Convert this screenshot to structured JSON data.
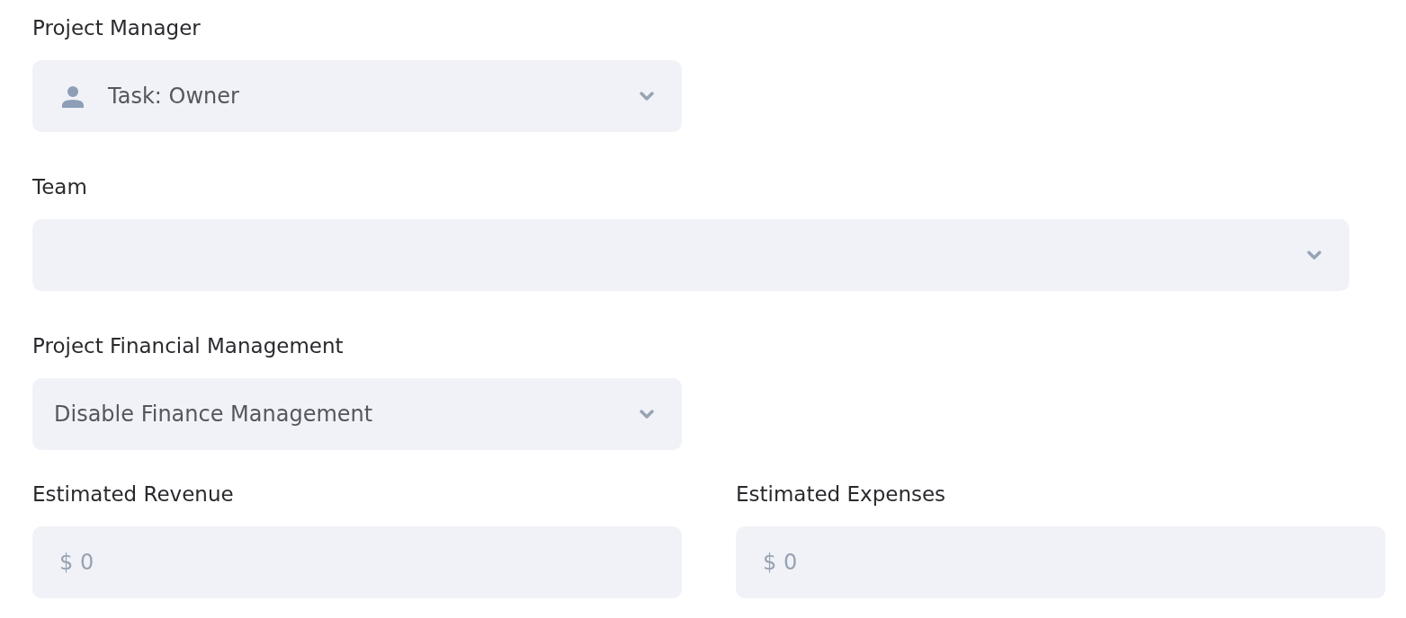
{
  "fields": [
    {
      "kind": "user-select",
      "label": "Project Manager",
      "value": "Task: Owner"
    },
    {
      "kind": "wide-select",
      "label": "Team"
    },
    {
      "kind": "select",
      "label": "Project Financial Management",
      "value": "Disable Finance Management"
    }
  ],
  "estimates": [
    {
      "label": "Estimated Revenue",
      "placeholder": "$ 0"
    },
    {
      "label": "Estimated Expenses",
      "placeholder": "$ 0"
    }
  ]
}
